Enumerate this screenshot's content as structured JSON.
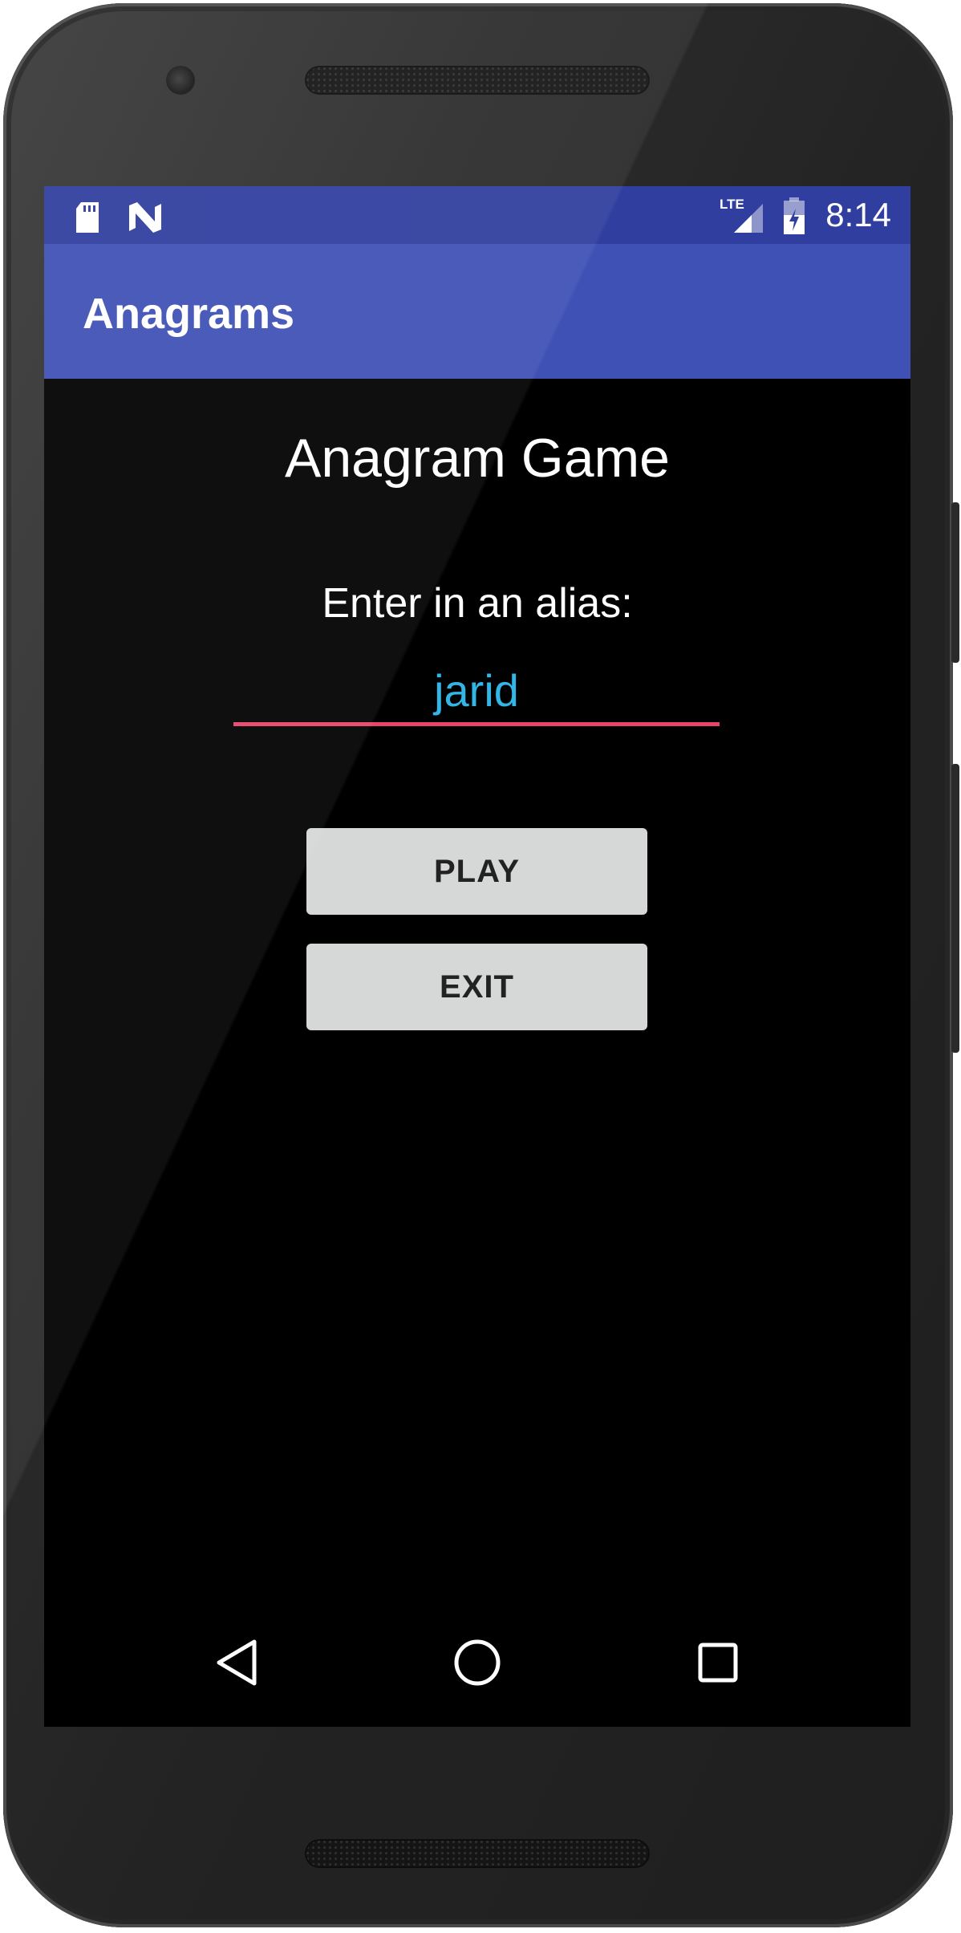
{
  "status_bar": {
    "time": "8:14",
    "network": "LTE",
    "left_icons": [
      "sd-card-icon",
      "n-notification-icon"
    ],
    "right_icons": [
      "lte-signal-icon",
      "battery-charging-icon"
    ]
  },
  "app_bar": {
    "title": "Anagrams"
  },
  "main": {
    "heading": "Anagram Game",
    "alias_prompt": "Enter in an alias:",
    "alias_value": "jarid",
    "play_label": "PLAY",
    "exit_label": "EXIT"
  },
  "nav_bar": {
    "buttons": [
      "back-icon",
      "home-icon",
      "recents-icon"
    ]
  },
  "colors": {
    "status_bar": "#303f9f",
    "app_bar": "#3f51b5",
    "input_underline": "#e8446b",
    "input_text": "#33b5e5",
    "button_bg": "#d6d7d7"
  }
}
